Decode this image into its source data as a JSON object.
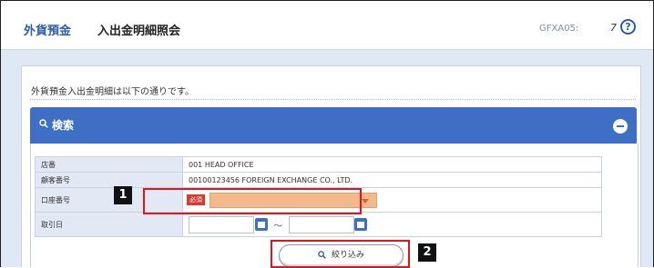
{
  "header": {
    "category": "外貨預金",
    "title": "入出金明細照会",
    "screen_code": "GFXA05:",
    "step": "7",
    "help_icon": "?"
  },
  "intro_text": "外貨預金入出金明細は以下の通りです。",
  "search_panel": {
    "title": "検索",
    "icon": "search-icon",
    "collapse_icon": "minus-circle-icon"
  },
  "form": {
    "rows": [
      {
        "label": "店番",
        "value": "001 HEAD OFFICE"
      },
      {
        "label": "顧客番号",
        "value": "00100123456 FOREIGN EXCHANGE CO., LTD."
      },
      {
        "label": "口座番号",
        "required": "必須",
        "value": ""
      },
      {
        "label": "取引日",
        "separator": "～",
        "from_value": "",
        "to_value": ""
      }
    ]
  },
  "filter_button": {
    "label": "絞り込み",
    "icon": "search-icon"
  },
  "annotations": {
    "badge1": "1",
    "badge2": "2",
    "color": "#e3141e"
  },
  "colors": {
    "accent": "#3e6fc5",
    "select_bg": "#f4b98a",
    "required_bg": "#d9382e"
  }
}
